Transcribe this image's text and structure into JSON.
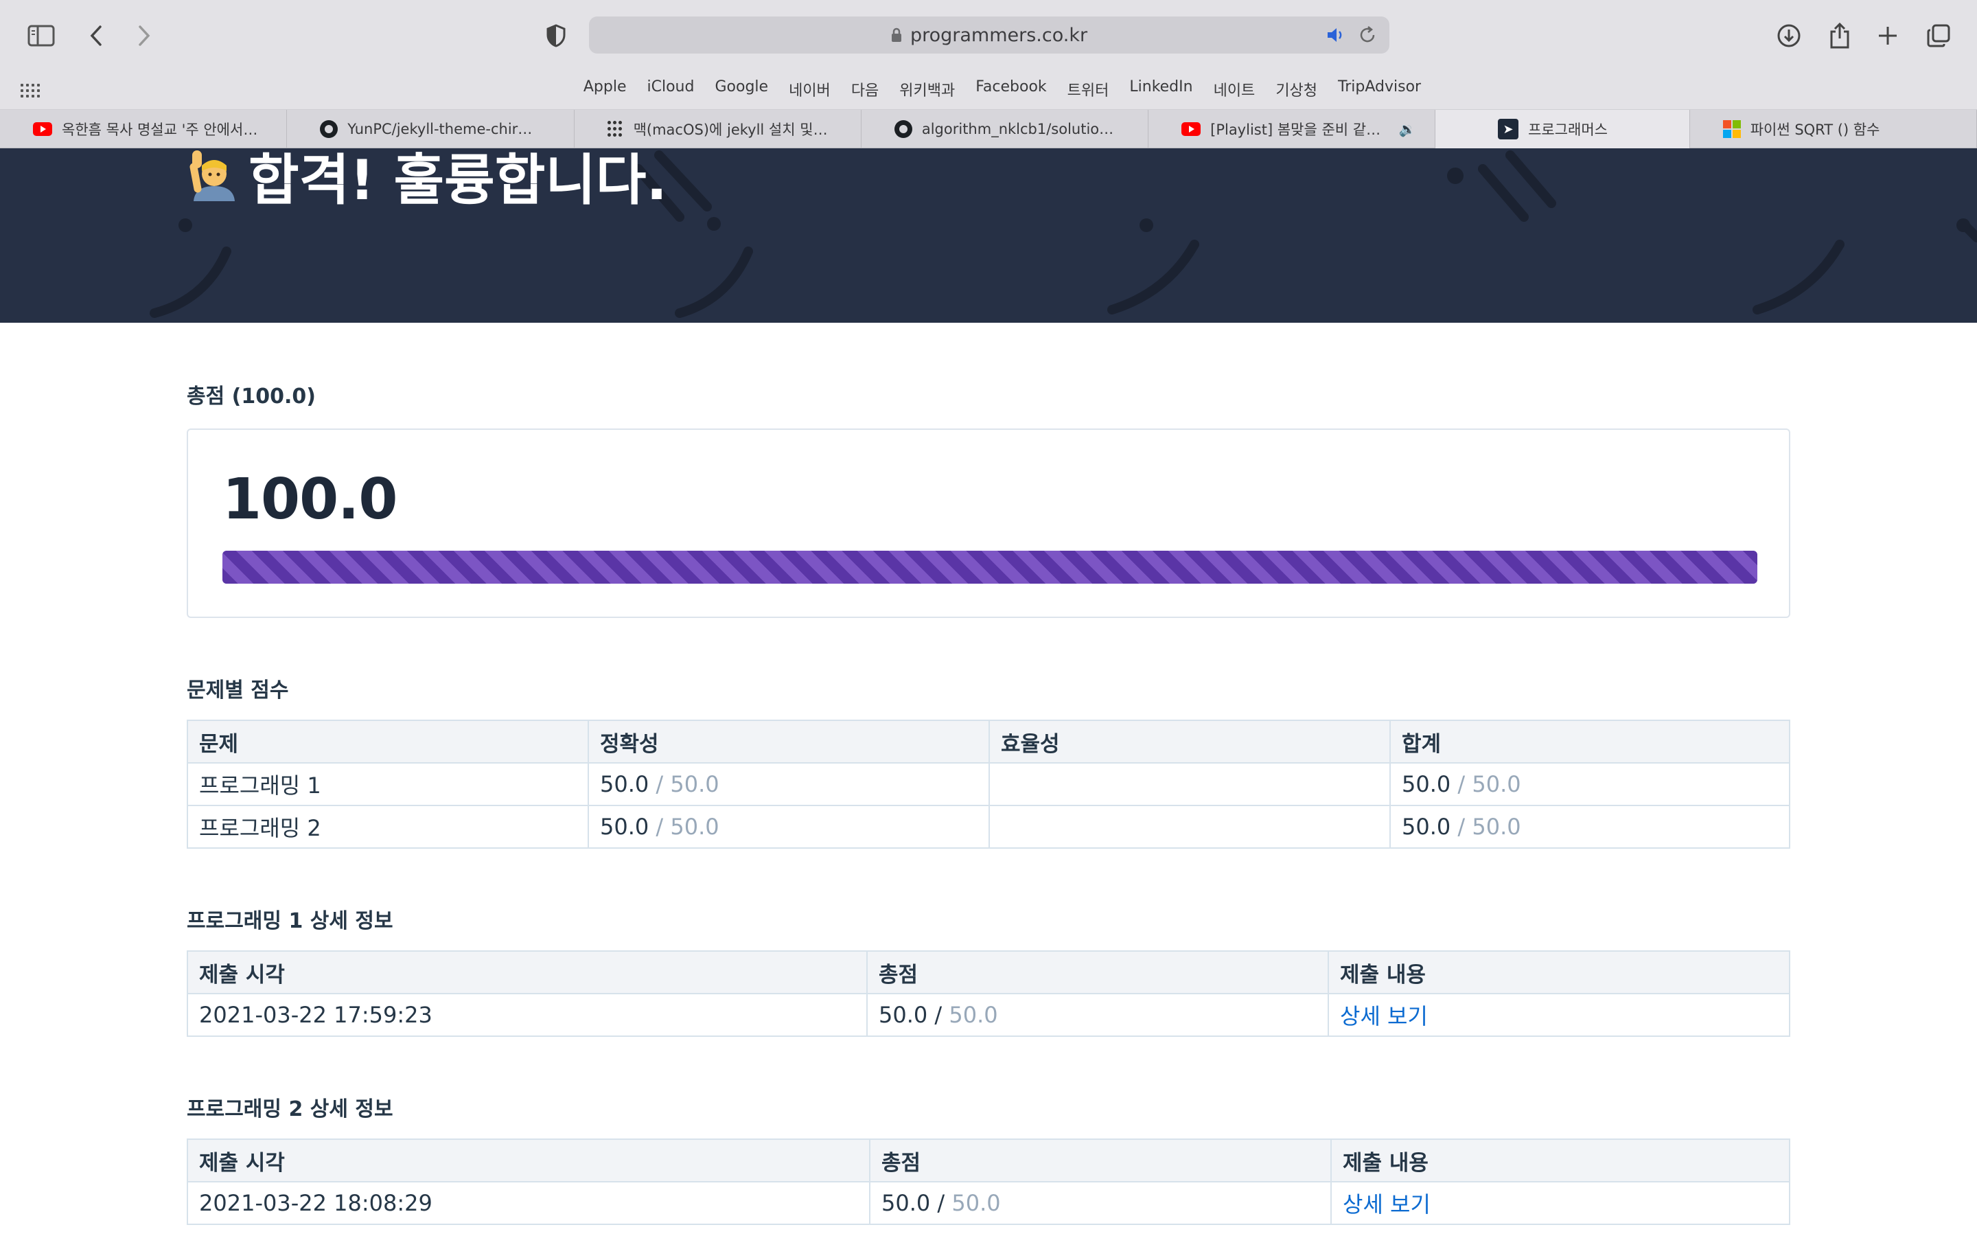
{
  "browser": {
    "url": "programmers.co.kr",
    "favorites": [
      "Apple",
      "iCloud",
      "Google",
      "네이버",
      "다음",
      "위키백과",
      "Facebook",
      "트위터",
      "LinkedIn",
      "네이트",
      "기상청",
      "TripAdvisor"
    ],
    "tabs": [
      {
        "label": "옥한흠 목사 명설교 '주 안에서…",
        "icon": "youtube-icon"
      },
      {
        "label": "YunPC/jekyll-theme-chir…",
        "icon": "github-icon"
      },
      {
        "label": "맥(macOS)에 jekyll 설치 및…",
        "icon": "dots-icon"
      },
      {
        "label": "algorithm_nklcb1/solutio…",
        "icon": "github-icon"
      },
      {
        "label": "[Playlist] 봄맞을 준비 같이…",
        "icon": "youtube-icon"
      },
      {
        "label": "프로그래머스",
        "icon": "programmers-icon",
        "active": true
      },
      {
        "label": "파이썬 SQRT () 함수",
        "icon": "microsoft-icon"
      }
    ]
  },
  "hero": {
    "title": "합격! 훌륭합니다."
  },
  "total": {
    "heading": "총점 (100.0)",
    "score": "100.0",
    "progress_percent": 100
  },
  "per_problem": {
    "heading": "문제별 점수",
    "columns": [
      "문제",
      "정확성",
      "효율성",
      "합계"
    ],
    "rows": [
      {
        "name": "프로그래밍 1",
        "accuracy": "50.0",
        "accuracy_max": "/ 50.0",
        "efficiency": "",
        "sum": "50.0",
        "sum_max": "/ 50.0"
      },
      {
        "name": "프로그래밍 2",
        "accuracy": "50.0",
        "accuracy_max": "/ 50.0",
        "efficiency": "",
        "sum": "50.0",
        "sum_max": "/ 50.0"
      }
    ]
  },
  "details": [
    {
      "heading": "프로그래밍 1 상세 정보",
      "columns": [
        "제출 시각",
        "총점",
        "제출 내용"
      ],
      "submitted_at": "2021-03-22 17:59:23",
      "score": "50.0 /",
      "score_max": "50.0",
      "link": "상세 보기"
    },
    {
      "heading": "프로그래밍 2 상세 정보",
      "columns": [
        "제출 시각",
        "총점",
        "제출 내용"
      ],
      "submitted_at": "2021-03-22 18:08:29",
      "score": "50.0 /",
      "score_max": "50.0",
      "link": "상세 보기"
    }
  ],
  "colors": {
    "hero_bg": "#263045",
    "progress": "#6f45b8",
    "link": "#0c6bd1"
  }
}
